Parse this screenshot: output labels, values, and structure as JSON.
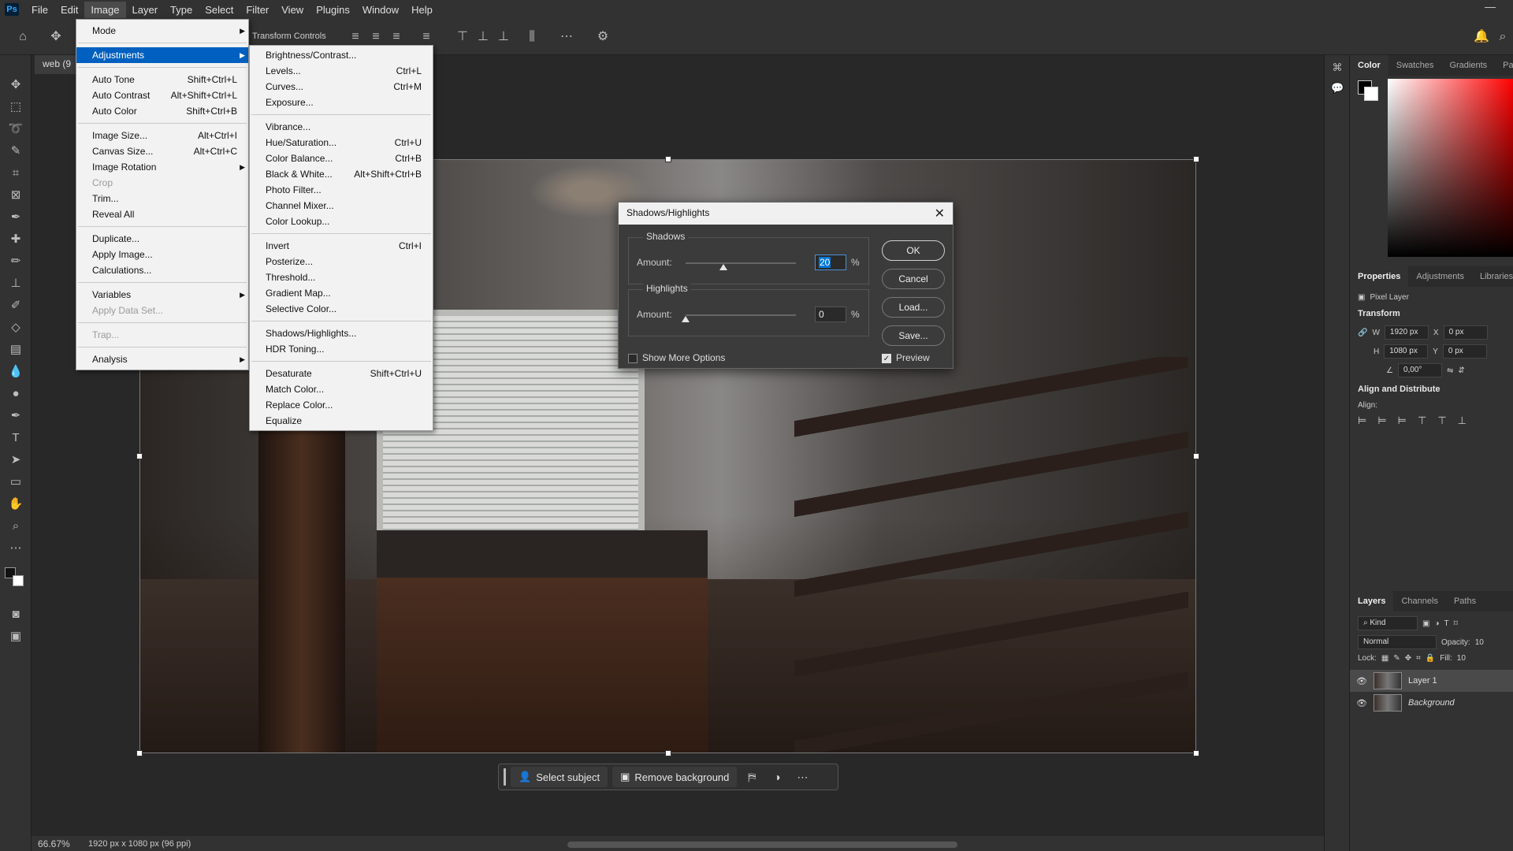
{
  "menubar": {
    "logo": "Ps",
    "items": [
      "File",
      "Edit",
      "Image",
      "Layer",
      "Type",
      "Select",
      "Filter",
      "View",
      "Plugins",
      "Window",
      "Help"
    ],
    "minimize": "—"
  },
  "options": {
    "transform_controls": "Transform Controls"
  },
  "document": {
    "tab_title": "web (9"
  },
  "image_menu": {
    "items": [
      {
        "label": "Mode",
        "shortcut": "",
        "submenu": true
      },
      {
        "label": "Adjustments",
        "shortcut": "",
        "submenu": true
      },
      {
        "label": "Auto Tone",
        "shortcut": "Shift+Ctrl+L"
      },
      {
        "label": "Auto Contrast",
        "shortcut": "Alt+Shift+Ctrl+L"
      },
      {
        "label": "Auto Color",
        "shortcut": "Shift+Ctrl+B"
      },
      {
        "label": "Image Size...",
        "shortcut": "Alt+Ctrl+I"
      },
      {
        "label": "Canvas Size...",
        "shortcut": "Alt+Ctrl+C"
      },
      {
        "label": "Image Rotation",
        "shortcut": "",
        "submenu": true
      },
      {
        "label": "Crop",
        "shortcut": ""
      },
      {
        "label": "Trim...",
        "shortcut": ""
      },
      {
        "label": "Reveal All",
        "shortcut": ""
      },
      {
        "label": "Duplicate...",
        "shortcut": ""
      },
      {
        "label": "Apply Image...",
        "shortcut": ""
      },
      {
        "label": "Calculations...",
        "shortcut": ""
      },
      {
        "label": "Variables",
        "shortcut": "",
        "submenu": true
      },
      {
        "label": "Apply Data Set...",
        "shortcut": ""
      },
      {
        "label": "Trap...",
        "shortcut": ""
      },
      {
        "label": "Analysis",
        "shortcut": "",
        "submenu": true
      }
    ]
  },
  "adjustments_menu": {
    "items": [
      {
        "label": "Brightness/Contrast...",
        "shortcut": ""
      },
      {
        "label": "Levels...",
        "shortcut": "Ctrl+L"
      },
      {
        "label": "Curves...",
        "shortcut": "Ctrl+M"
      },
      {
        "label": "Exposure...",
        "shortcut": ""
      },
      {
        "label": "Vibrance...",
        "shortcut": ""
      },
      {
        "label": "Hue/Saturation...",
        "shortcut": "Ctrl+U"
      },
      {
        "label": "Color Balance...",
        "shortcut": "Ctrl+B"
      },
      {
        "label": "Black & White...",
        "shortcut": "Alt+Shift+Ctrl+B"
      },
      {
        "label": "Photo Filter...",
        "shortcut": ""
      },
      {
        "label": "Channel Mixer...",
        "shortcut": ""
      },
      {
        "label": "Color Lookup...",
        "shortcut": ""
      },
      {
        "label": "Invert",
        "shortcut": "Ctrl+I"
      },
      {
        "label": "Posterize...",
        "shortcut": ""
      },
      {
        "label": "Threshold...",
        "shortcut": ""
      },
      {
        "label": "Gradient Map...",
        "shortcut": ""
      },
      {
        "label": "Selective Color...",
        "shortcut": ""
      },
      {
        "label": "Shadows/Highlights...",
        "shortcut": ""
      },
      {
        "label": "HDR Toning...",
        "shortcut": ""
      },
      {
        "label": "Desaturate",
        "shortcut": "Shift+Ctrl+U"
      },
      {
        "label": "Match Color...",
        "shortcut": ""
      },
      {
        "label": "Replace Color...",
        "shortcut": ""
      },
      {
        "label": "Equalize",
        "shortcut": ""
      }
    ]
  },
  "dialog": {
    "title": "Shadows/Highlights",
    "shadows_label": "Shadows",
    "highlights_label": "Highlights",
    "amount_label": "Amount:",
    "shadows_amount": "20",
    "highlights_amount": "0",
    "percent": "%",
    "ok": "OK",
    "cancel": "Cancel",
    "load": "Load...",
    "save": "Save...",
    "show_more": "Show More Options",
    "preview": "Preview"
  },
  "taskbar": {
    "select_subject": "Select subject",
    "remove_background": "Remove background"
  },
  "status": {
    "zoom": "66.67%",
    "doc_info": "1920 px x 1080 px (96 ppi)"
  },
  "panels": {
    "color_tabs": [
      "Color",
      "Swatches",
      "Gradients",
      "Patte"
    ],
    "prop_tabs": [
      "Properties",
      "Adjustments",
      "Libraries"
    ],
    "pixel_layer": "Pixel Layer",
    "transform": "Transform",
    "w_label": "W",
    "w_value": "1920 px",
    "h_label": "H",
    "h_value": "1080 px",
    "x_label": "X",
    "x_value": "0 px",
    "y_label": "Y",
    "y_value": "0 px",
    "angle": "0,00°",
    "align_distribute": "Align and Distribute",
    "align_label": "Align:",
    "layer_tabs": [
      "Layers",
      "Channels",
      "Paths"
    ],
    "kind": "Kind",
    "blend_mode": "Normal",
    "opacity_label": "Opacity:",
    "opacity_value": "10",
    "lock_label": "Lock:",
    "fill_label": "Fill:",
    "fill_value": "10",
    "layers": [
      "Layer 1",
      "Background"
    ]
  }
}
